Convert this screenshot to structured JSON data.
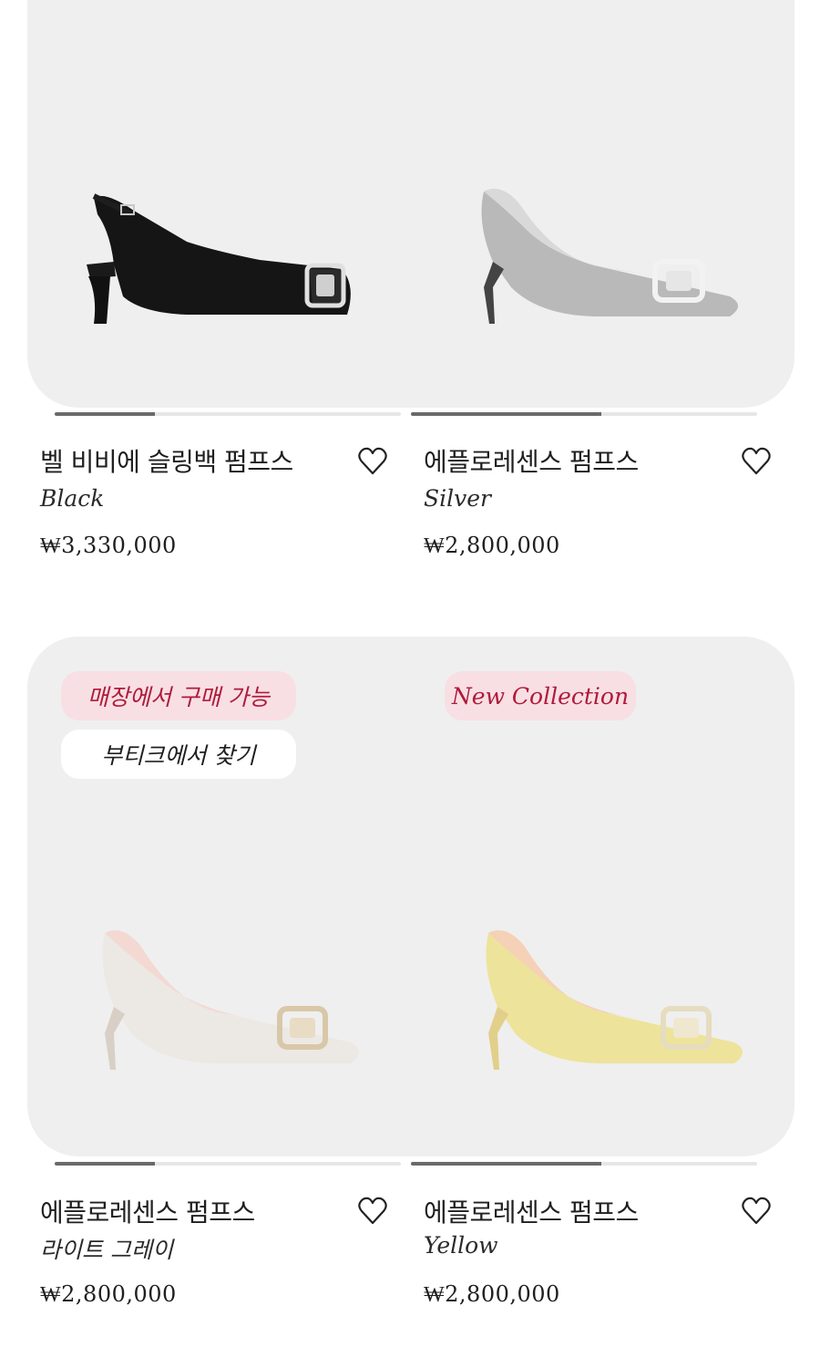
{
  "colors": {
    "card_background": "#efefef",
    "badge_pink_bg": "#f8dfe3",
    "badge_pink_text": "#b01a3c",
    "progress_fill": "#6a6a6a",
    "progress_track": "#e6e6e6"
  },
  "products": [
    {
      "title": "벨 비비에 슬링백 펌프스",
      "variant": "Black",
      "price": "₩3,330,000",
      "image_progress": 0.29,
      "favorite_icon": "heart-outline-icon",
      "badges": []
    },
    {
      "title": "에플로레센스 펌프스",
      "variant": "Silver",
      "price": "₩2,800,000",
      "image_progress": 0.55,
      "favorite_icon": "heart-outline-icon",
      "badges": []
    },
    {
      "title": "에플로레센스 펌프스",
      "variant": "라이트 그레이",
      "price": "₩2,800,000",
      "image_progress": 0.29,
      "favorite_icon": "heart-outline-icon",
      "badges": [
        "매장에서 구매 가능",
        "부티크에서 찾기"
      ]
    },
    {
      "title": "에플로레센스 펌프스",
      "variant": "Yellow",
      "price": "₩2,800,000",
      "image_progress": 0.55,
      "favorite_icon": "heart-outline-icon",
      "badges": [
        "New Collection"
      ]
    }
  ]
}
